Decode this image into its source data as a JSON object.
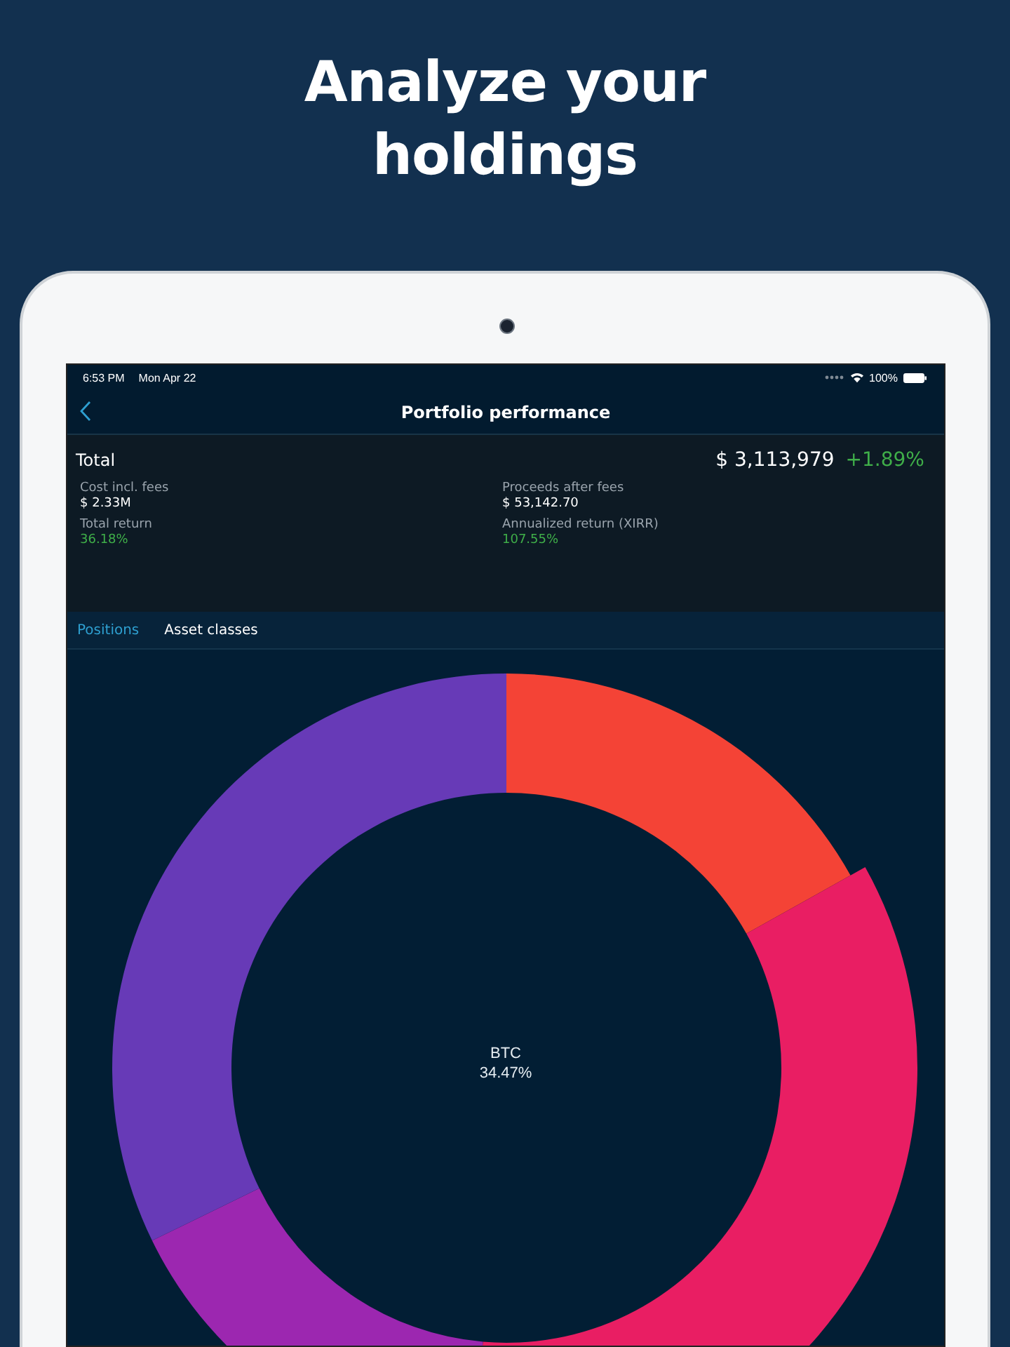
{
  "headline": "Analyze your holdings",
  "status_bar": {
    "time": "6:53 PM",
    "date": "Mon Apr 22",
    "battery": "100%"
  },
  "nav": {
    "title": "Portfolio performance"
  },
  "summary": {
    "title": "Total",
    "value": "$ 3,113,979",
    "change": "+1.89%",
    "metrics": [
      {
        "label": "Cost incl. fees",
        "value": "$ 2.33M",
        "kind": "amount"
      },
      {
        "label": "Proceeds after fees",
        "value": "$ 53,142.70",
        "kind": "amount"
      },
      {
        "label": "Total return",
        "value": "36.18%",
        "kind": "gain"
      },
      {
        "label": "Annualized return (XIRR)",
        "value": "107.55%",
        "kind": "gain"
      }
    ]
  },
  "tabs": [
    {
      "label": "Positions",
      "selected": true
    },
    {
      "label": "Asset classes",
      "selected": false
    }
  ],
  "donut": {
    "label": "BTC",
    "value": "34.47%"
  }
}
